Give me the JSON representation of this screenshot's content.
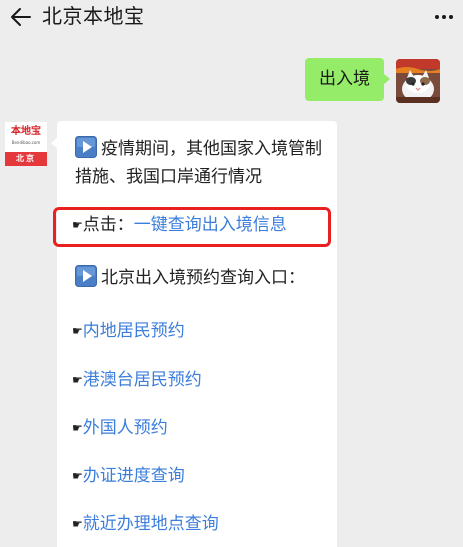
{
  "header": {
    "title": "北京本地宝",
    "back_icon": "arrow-left-icon",
    "more_icon": "more-dots-icon"
  },
  "my_message": {
    "text": "出入境",
    "bubble_color": "#95ec69"
  },
  "account_avatar": {
    "logo_text": "本地宝",
    "logo_url": "Bendibao.com",
    "city": "北京",
    "brand_color": "#e4383c"
  },
  "article": {
    "intro": "疫情期间，其他国家入境管制措施、我国口岸通行情况",
    "click_prefix": "点击：",
    "click_link": "一键查询出入境信息",
    "section_title": "北京出入境预约查询入口：",
    "links": [
      "内地居民预约",
      "港澳台居民预约",
      "外国人预约",
      "办证进度查询",
      "就近办理地点查询"
    ],
    "link_color": "#3c7edc",
    "highlight_color": "#e8201f"
  }
}
